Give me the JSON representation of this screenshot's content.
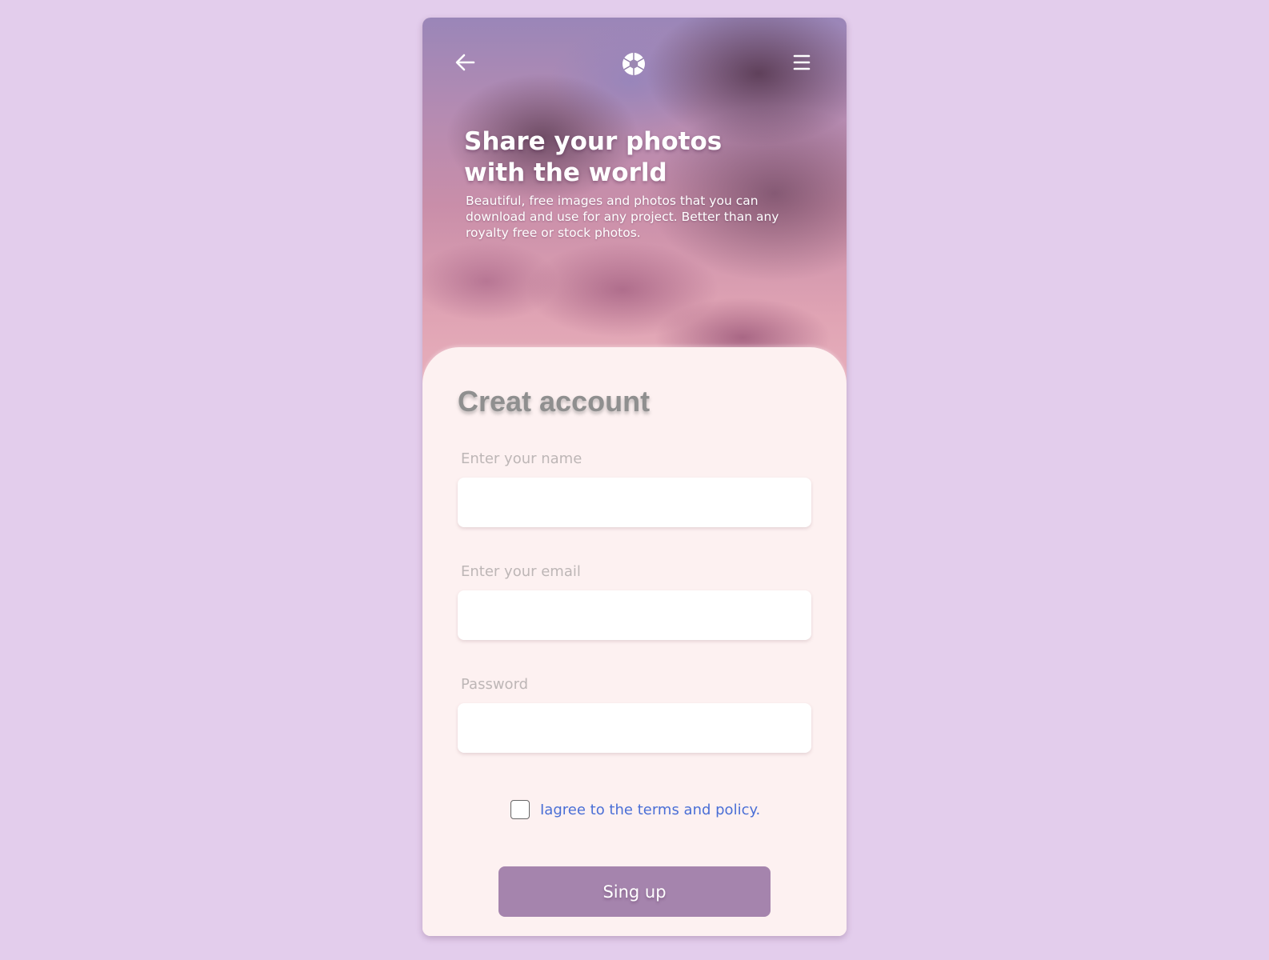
{
  "nav": {
    "back_icon": "arrow-left-icon",
    "logo_icon": "camera-aperture-icon",
    "menu_icon": "hamburger-menu-icon"
  },
  "hero": {
    "title": "Share your photos with the world",
    "subtitle": "Beautiful, free images and photos that you can download and use for any project. Better than any royalty free or stock photos."
  },
  "form": {
    "title": "Creat account",
    "fields": [
      {
        "label": "Enter your name",
        "value": "",
        "placeholder": ""
      },
      {
        "label": "Enter your email",
        "value": "",
        "placeholder": ""
      },
      {
        "label": "Password",
        "value": "",
        "placeholder": ""
      }
    ],
    "agree_text": "Iagree to the terms and policy.",
    "agree_checked": false,
    "submit_label": "Sing up"
  },
  "colors": {
    "page_background": "#e3cdec",
    "card_background": "#fdf1f1",
    "button": "#a584ad",
    "link": "#4a6fd6",
    "label": "#bdb6b6",
    "title": "#8f8f8f"
  }
}
